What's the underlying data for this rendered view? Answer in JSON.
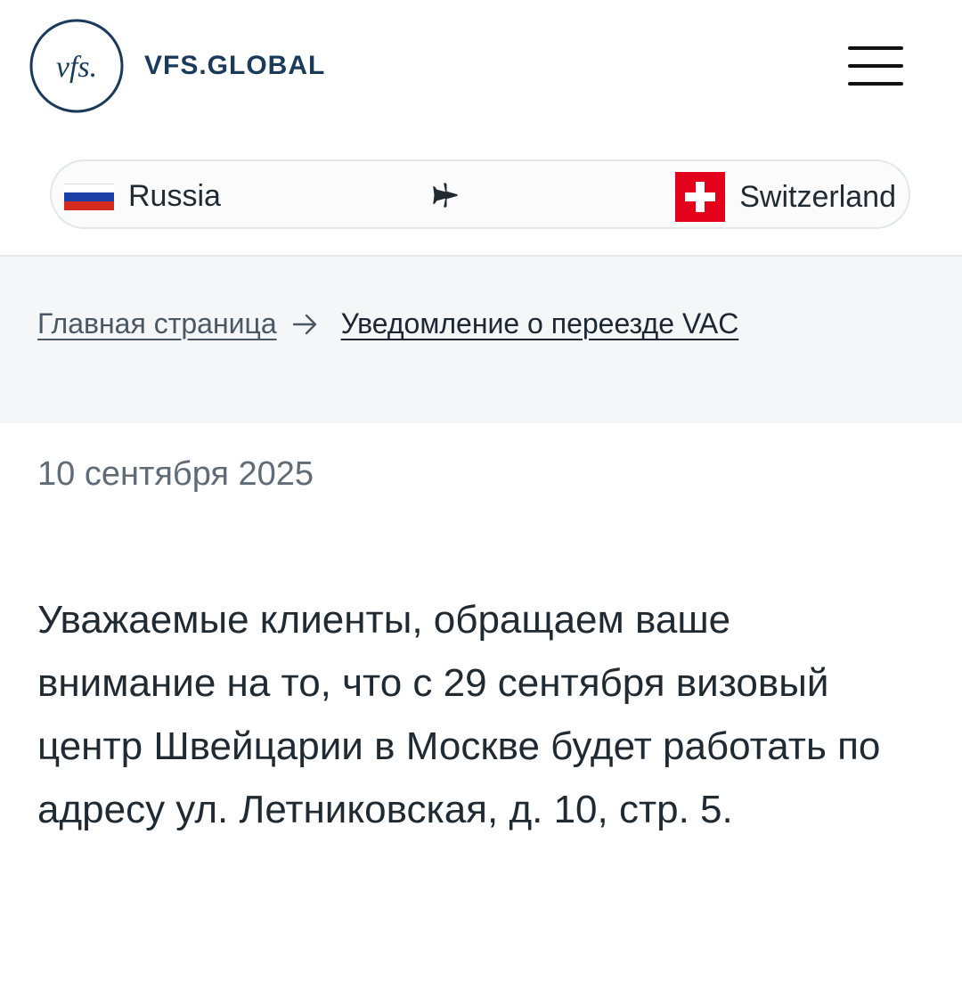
{
  "header": {
    "logo_mark": "vfs.",
    "logo_wordmark": "VFS.GLOBAL",
    "menu_icon": "hamburger-menu-icon"
  },
  "route": {
    "origin": "Russia",
    "origin_flag": "russia-flag-icon",
    "direction_icon": "airplane-icon",
    "destination": "Switzerland",
    "destination_flag": "switzerland-flag-icon"
  },
  "breadcrumb": {
    "home": "Главная страница",
    "separator_icon": "arrow-right-icon",
    "current": "Уведомление о переезде VAC"
  },
  "article": {
    "date": "10 сентября 2025",
    "body": "Уважаемые клиенты, обращаем ваше внимание на то, что с 29 сентября визовый центр Швейцарии в Москве будет работать по адресу ул. Летниковская, д. 10, стр. 5."
  },
  "colors": {
    "brand_navy": "#1a3a5c",
    "text_primary": "#1f2a33",
    "text_muted": "#5f6b77",
    "band_background": "#f5f6f8",
    "swiss_red": "#e3001b"
  }
}
